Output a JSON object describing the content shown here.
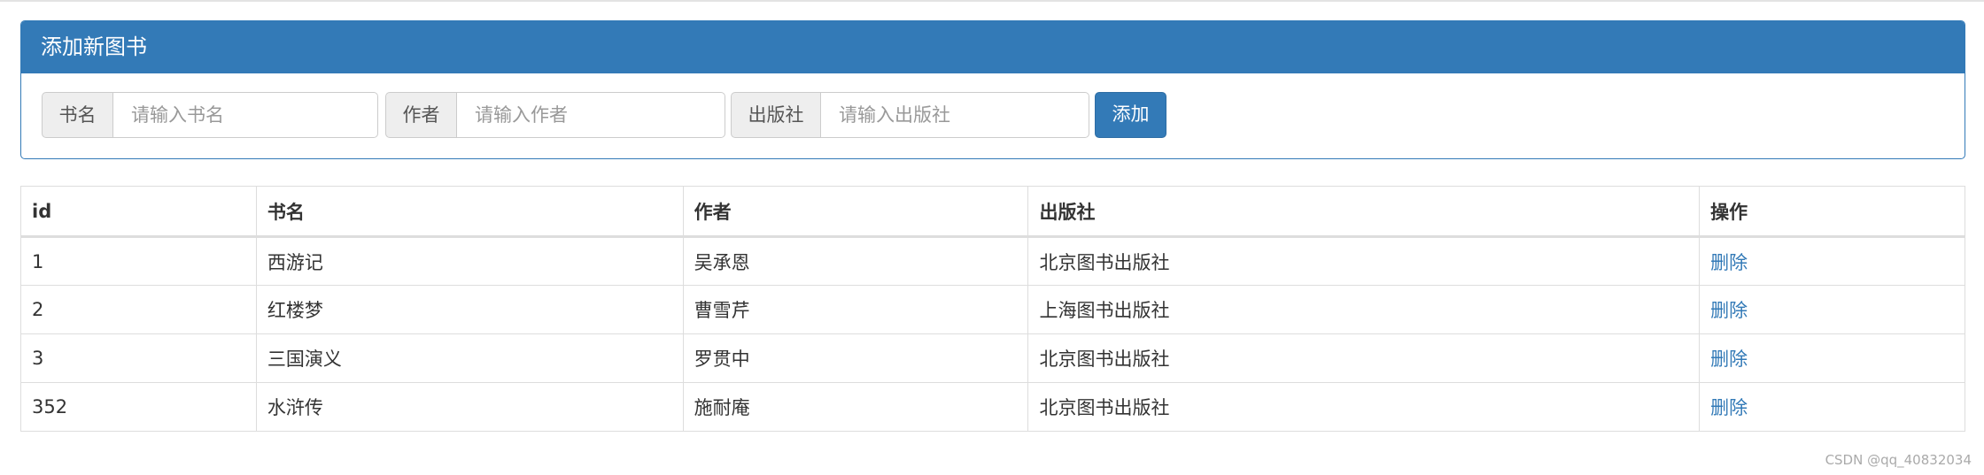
{
  "panel": {
    "title": "添加新图书"
  },
  "form": {
    "name_label": "书名",
    "name_placeholder": "请输入书名",
    "author_label": "作者",
    "author_placeholder": "请输入作者",
    "publisher_label": "出版社",
    "publisher_placeholder": "请输入出版社",
    "add_label": "添加"
  },
  "table": {
    "headers": [
      "id",
      "书名",
      "作者",
      "出版社",
      "操作"
    ],
    "rows": [
      {
        "id": "1",
        "name": "西游记",
        "author": "吴承恩",
        "publisher": "北京图书出版社",
        "action": "删除"
      },
      {
        "id": "2",
        "name": "红楼梦",
        "author": "曹雪芹",
        "publisher": "上海图书出版社",
        "action": "删除"
      },
      {
        "id": "3",
        "name": "三国演义",
        "author": "罗贯中",
        "publisher": "北京图书出版社",
        "action": "删除"
      },
      {
        "id": "352",
        "name": "水浒传",
        "author": "施耐庵",
        "publisher": "北京图书出版社",
        "action": "删除"
      }
    ]
  },
  "watermark": "CSDN @qq_40832034"
}
